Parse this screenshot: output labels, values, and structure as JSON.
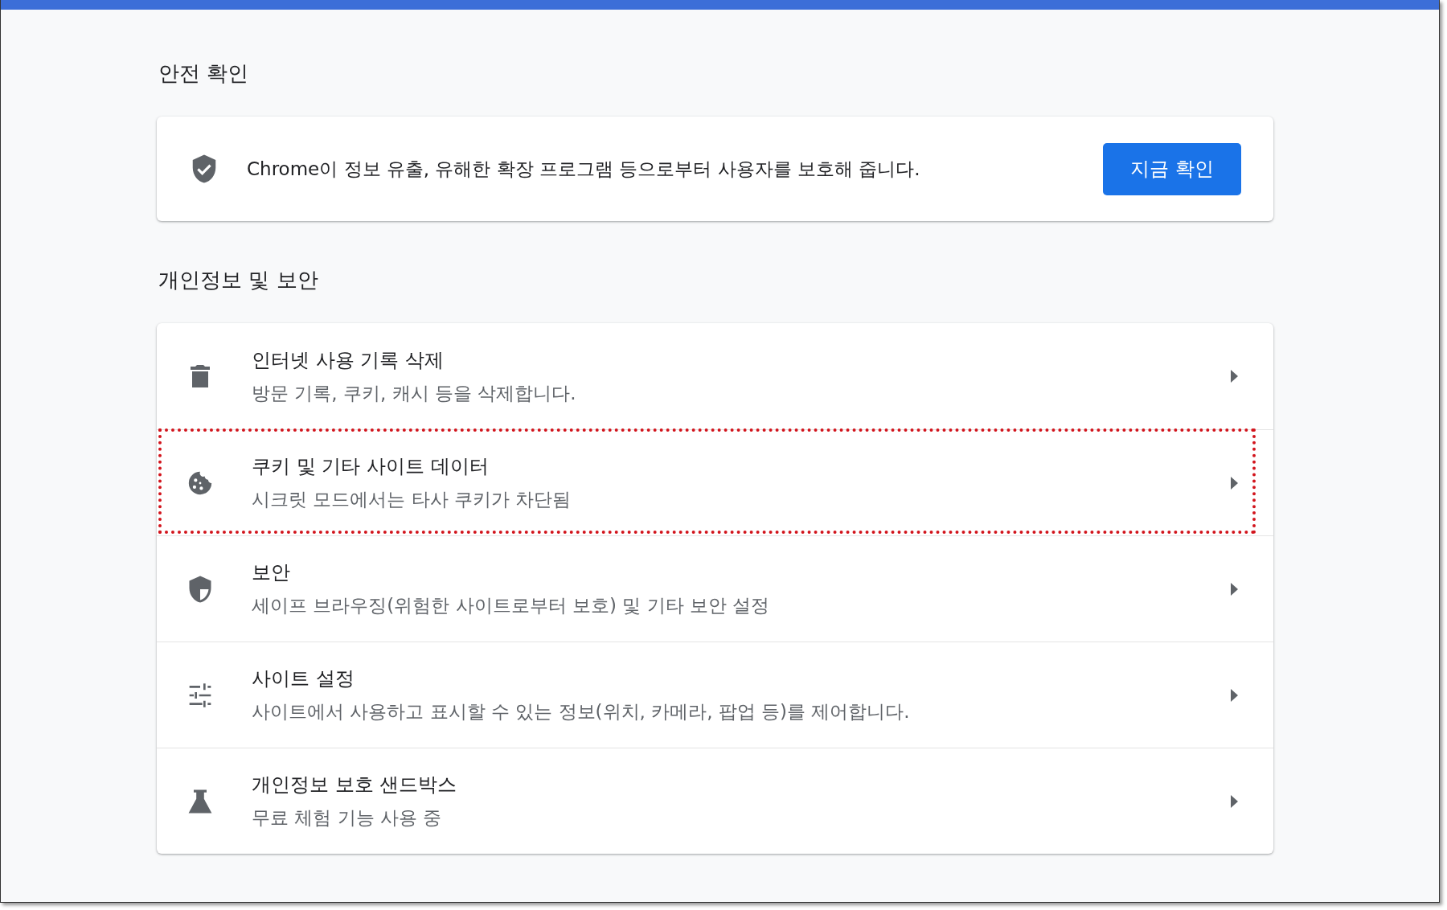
{
  "safety_check": {
    "title": "안전 확인",
    "description": "Chrome이 정보 유출, 유해한 확장 프로그램 등으로부터 사용자를 보호해 줍니다.",
    "button": "지금 확인"
  },
  "privacy": {
    "title": "개인정보 및 보안",
    "items": [
      {
        "kind": "trash",
        "title": "인터넷 사용 기록 삭제",
        "subtitle": "방문 기록, 쿠키, 캐시 등을 삭제합니다.",
        "highlighted": false
      },
      {
        "kind": "cookie",
        "title": "쿠키 및 기타 사이트 데이터",
        "subtitle": "시크릿 모드에서는 타사 쿠키가 차단됨",
        "highlighted": true
      },
      {
        "kind": "shield",
        "title": "보안",
        "subtitle": "세이프 브라우징(위험한 사이트로부터 보호) 및 기타 보안 설정",
        "highlighted": false
      },
      {
        "kind": "sliders",
        "title": "사이트 설정",
        "subtitle": "사이트에서 사용하고 표시할 수 있는 정보(위치, 카메라, 팝업 등)를 제어합니다.",
        "highlighted": false
      },
      {
        "kind": "flask",
        "title": "개인정보 보호 샌드박스",
        "subtitle": "무료 체험 기능 사용 중",
        "highlighted": false
      }
    ]
  }
}
